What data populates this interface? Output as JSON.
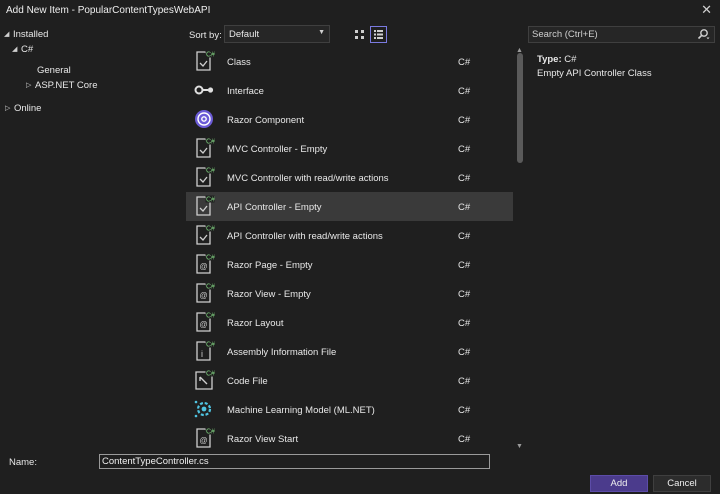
{
  "window": {
    "title": "Add New Item - PopularContentTypesWebAPI",
    "close_glyph": "✕"
  },
  "tree": {
    "installed": "Installed",
    "csharp": "C#",
    "general": "General",
    "aspnet": "ASP.NET Core",
    "online": "Online"
  },
  "toolbar": {
    "sort_label": "Sort by:",
    "sort_value": "Default"
  },
  "search": {
    "placeholder": "Search (Ctrl+E)"
  },
  "templates": [
    {
      "name": "Class",
      "lang": "C#",
      "icon": "class-file-icon"
    },
    {
      "name": "Interface",
      "lang": "C#",
      "icon": "interface-icon"
    },
    {
      "name": "Razor Component",
      "lang": "C#",
      "icon": "razor-component-icon"
    },
    {
      "name": "MVC Controller - Empty",
      "lang": "C#",
      "icon": "controller-file-icon"
    },
    {
      "name": "MVC Controller with read/write actions",
      "lang": "C#",
      "icon": "controller-file-icon"
    },
    {
      "name": "API Controller - Empty",
      "lang": "C#",
      "icon": "controller-file-icon",
      "selected": true
    },
    {
      "name": "API Controller with read/write actions",
      "lang": "C#",
      "icon": "controller-file-icon"
    },
    {
      "name": "Razor Page - Empty",
      "lang": "C#",
      "icon": "razor-page-icon"
    },
    {
      "name": "Razor View - Empty",
      "lang": "C#",
      "icon": "razor-view-icon"
    },
    {
      "name": "Razor Layout",
      "lang": "C#",
      "icon": "razor-layout-icon"
    },
    {
      "name": "Assembly Information File",
      "lang": "C#",
      "icon": "assembly-info-icon"
    },
    {
      "name": "Code File",
      "lang": "C#",
      "icon": "code-file-icon"
    },
    {
      "name": "Machine Learning Model (ML.NET)",
      "lang": "C#",
      "icon": "ml-model-icon"
    },
    {
      "name": "Razor View Start",
      "lang": "C#",
      "icon": "razor-viewstart-icon"
    }
  ],
  "details": {
    "type_key": "Type:",
    "type_value": "C#",
    "description": "Empty API Controller Class"
  },
  "bottom": {
    "name_label": "Name:",
    "name_value": "ContentTypeController.cs",
    "add_label": "Add",
    "cancel_label": "Cancel"
  },
  "colors": {
    "accent": "#4b3b8c",
    "selection": "#3a3a3a",
    "background": "#1f1f1f",
    "razor": "#6b5bd6",
    "badge": "#7fd07f"
  }
}
